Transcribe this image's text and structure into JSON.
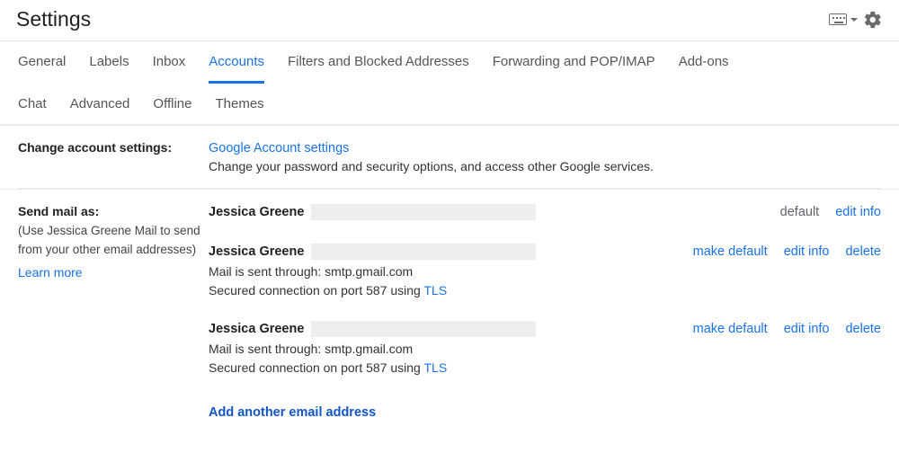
{
  "header": {
    "title": "Settings"
  },
  "tabsRow1": [
    "General",
    "Labels",
    "Inbox",
    "Accounts",
    "Filters and Blocked Addresses",
    "Forwarding and POP/IMAP",
    "Add-ons"
  ],
  "tabsRow2": [
    "Chat",
    "Advanced",
    "Offline",
    "Themes"
  ],
  "activeTab": "Accounts",
  "changeAccount": {
    "label": "Change account settings:",
    "link": "Google Account settings",
    "desc": "Change your password and security options, and access other Google services."
  },
  "sendMail": {
    "label": "Send mail as:",
    "sub": "(Use Jessica Greene Mail to send from your other email addresses)",
    "learnMore": "Learn more",
    "entries": [
      {
        "name": "Jessica Greene",
        "isDefault": true,
        "defaultLabel": "default",
        "makeDefault": "",
        "editInfo": "edit info",
        "delete": "",
        "smtp": "",
        "secured": ""
      },
      {
        "name": "Jessica Greene",
        "isDefault": false,
        "defaultLabel": "",
        "makeDefault": "make default",
        "editInfo": "edit info",
        "delete": "delete",
        "smtp": "Mail is sent through: smtp.gmail.com",
        "securedPrefix": "Secured connection on port 587 using ",
        "tls": "TLS"
      },
      {
        "name": "Jessica Greene",
        "isDefault": false,
        "defaultLabel": "",
        "makeDefault": "make default",
        "editInfo": "edit info",
        "delete": "delete",
        "smtp": "Mail is sent through: smtp.gmail.com",
        "securedPrefix": "Secured connection on port 587 using ",
        "tls": "TLS"
      }
    ],
    "addAnother": "Add another email address"
  }
}
